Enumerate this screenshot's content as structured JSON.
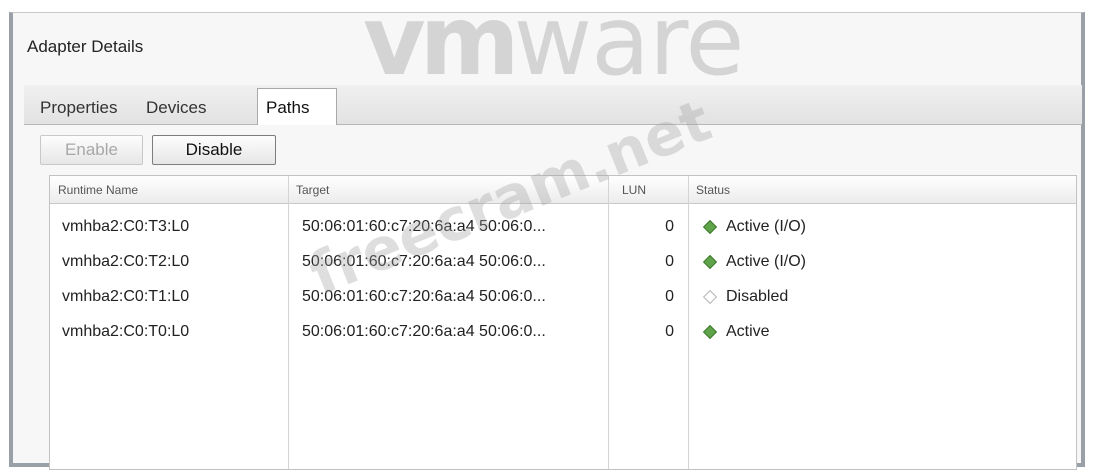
{
  "logo_text": {
    "bold": "vm",
    "light": "ware"
  },
  "watermark": "freecram.net",
  "panel": {
    "title": "Adapter Details"
  },
  "tabs": [
    {
      "label": "Properties",
      "active": false
    },
    {
      "label": "Devices",
      "active": false
    },
    {
      "label": "Paths",
      "active": true
    }
  ],
  "toolbar": {
    "enable_label": "Enable",
    "enable_enabled": false,
    "disable_label": "Disable",
    "disable_enabled": true
  },
  "table": {
    "columns": [
      "Runtime Name",
      "Target",
      "LUN",
      "Status"
    ],
    "rows": [
      {
        "runtime_name": "vmhba2:C0:T3:L0",
        "target": "50:06:01:60:c7:20:6a:a4 50:06:0...",
        "lun": "0",
        "status": "Active (I/O)",
        "status_icon": "green-diamond-icon"
      },
      {
        "runtime_name": "vmhba2:C0:T2:L0",
        "target": "50:06:01:60:c7:20:6a:a4 50:06:0...",
        "lun": "0",
        "status": "Active (I/O)",
        "status_icon": "green-diamond-icon"
      },
      {
        "runtime_name": "vmhba2:C0:T1:L0",
        "target": "50:06:01:60:c7:20:6a:a4 50:06:0...",
        "lun": "0",
        "status": "Disabled",
        "status_icon": "empty-diamond-icon"
      },
      {
        "runtime_name": "vmhba2:C0:T0:L0",
        "target": "50:06:01:60:c7:20:6a:a4 50:06:0...",
        "lun": "0",
        "status": "Active",
        "status_icon": "green-diamond-icon"
      }
    ]
  },
  "colors": {
    "active_status": "#5fa34a",
    "disabled_status": "#b5b5b5",
    "window_border": "#9aa0a8"
  }
}
